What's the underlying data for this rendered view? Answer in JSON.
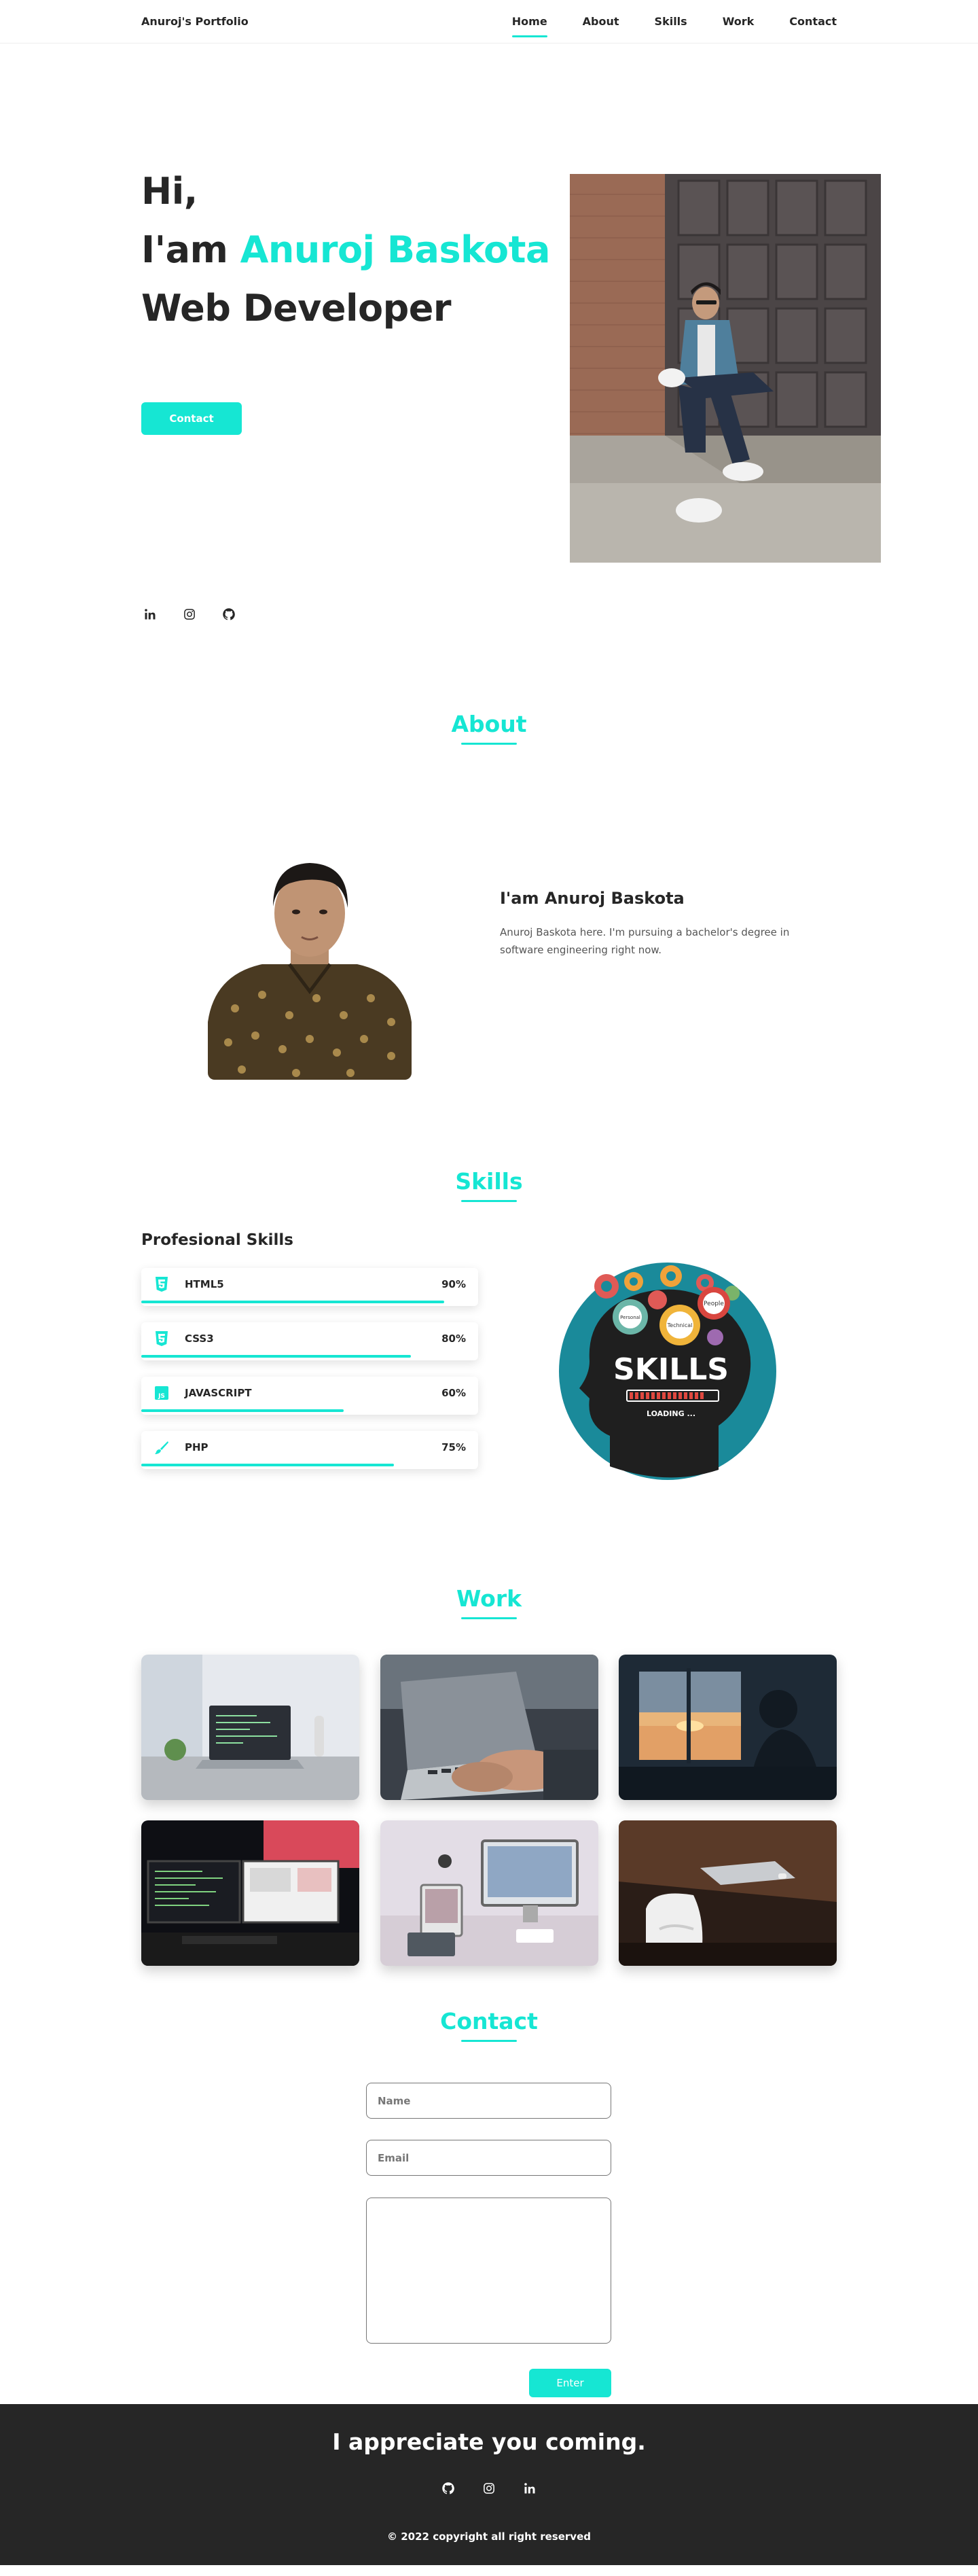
{
  "brand": "Anuroj's Portfolio",
  "nav": {
    "items": [
      {
        "label": "Home",
        "active": true
      },
      {
        "label": "About",
        "active": false
      },
      {
        "label": "Skills",
        "active": false
      },
      {
        "label": "Work",
        "active": false
      },
      {
        "label": "Contact",
        "active": false
      }
    ]
  },
  "home": {
    "greeting": "Hi,",
    "intro_prefix": "I'am ",
    "name": "Anuroj Baskota",
    "role": "Web Developer",
    "button_label": "Contact",
    "social_icons": [
      "linkedin-icon",
      "instagram-icon",
      "github-icon"
    ]
  },
  "about": {
    "title": "About",
    "subtitle": "I'am Anuroj Baskota",
    "description": "Anuroj Baskota here. I'm pursuing a bachelor's degree in software engineering right now."
  },
  "skills": {
    "title": "Skills",
    "subtitle": "Profesional Skills",
    "items": [
      {
        "name": "HTML5",
        "percent_label": "90%",
        "percent": 90,
        "icon": "html5-icon"
      },
      {
        "name": "CSS3",
        "percent_label": "80%",
        "percent": 80,
        "icon": "css3-icon"
      },
      {
        "name": "JAVASCRIPT",
        "percent_label": "60%",
        "percent": 60,
        "icon": "javascript-icon"
      },
      {
        "name": "PHP",
        "percent_label": "75%",
        "percent": 75,
        "icon": "brush-icon"
      }
    ],
    "graphic": {
      "headline": "SKILLS",
      "loading": "LOADING ...",
      "gear_words": [
        "Personal",
        "Technical",
        "People"
      ]
    }
  },
  "work": {
    "title": "Work"
  },
  "contact": {
    "title": "Contact",
    "name_placeholder": "Name",
    "email_placeholder": "Email",
    "submit_label": "Enter"
  },
  "footer": {
    "title": "I appreciate you coming.",
    "copyright": "© 2022 copyright all right reserved",
    "social_icons": [
      "github-icon",
      "instagram-icon",
      "linkedin-icon"
    ]
  },
  "colors": {
    "accent": "#16e6d3",
    "text": "#262626",
    "footer_bg": "#262626"
  }
}
